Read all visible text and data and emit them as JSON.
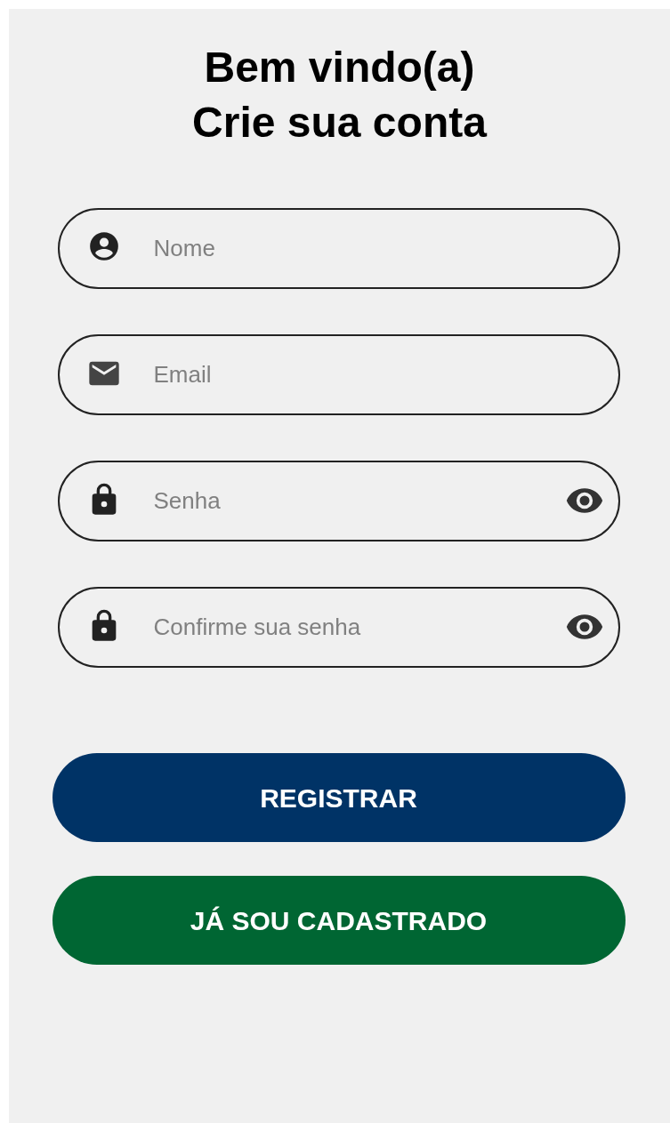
{
  "header": {
    "lines": [
      "Bem vindo(a)",
      "Crie sua conta"
    ]
  },
  "fields": [
    {
      "kind": "person",
      "placeholder": "Nome"
    },
    {
      "kind": "email",
      "placeholder": "Email"
    },
    {
      "kind": "password",
      "placeholder": "Senha"
    },
    {
      "kind": "password",
      "placeholder": "Confirme sua senha"
    }
  ],
  "buttons": [
    {
      "label": "REGISTRAR",
      "color": "#003366"
    },
    {
      "label": "JÁ SOU CADASTRADO",
      "color": "#006633"
    }
  ]
}
